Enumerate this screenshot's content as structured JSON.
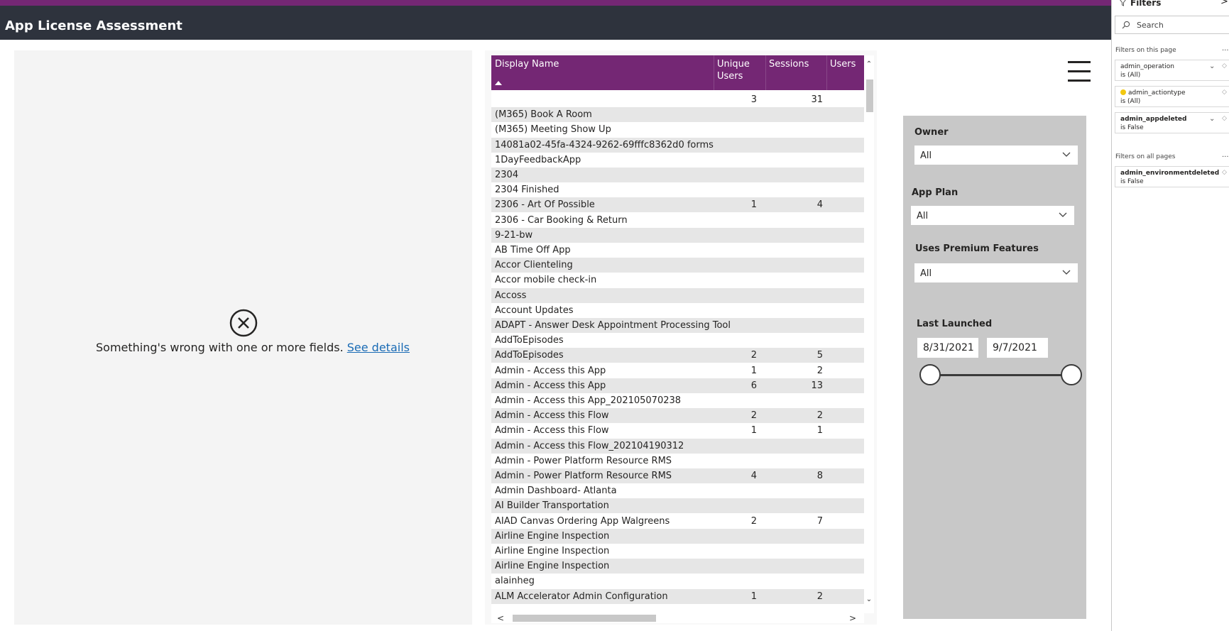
{
  "header": {
    "title": "App License Assessment"
  },
  "error": {
    "message": "Something's wrong with one or more fields.",
    "link": "See details"
  },
  "table": {
    "columns": [
      "Display Name",
      "Unique Users",
      "Sessions",
      "Users"
    ],
    "rows": [
      {
        "name": "",
        "unique_users": "3",
        "sessions": "31"
      },
      {
        "name": "(M365) Book A Room",
        "unique_users": "",
        "sessions": ""
      },
      {
        "name": "(M365) Meeting Show Up",
        "unique_users": "",
        "sessions": ""
      },
      {
        "name": "14081a02-45fa-4324-9262-69fffc8362d0 forms",
        "unique_users": "",
        "sessions": ""
      },
      {
        "name": "1DayFeedbackApp",
        "unique_users": "",
        "sessions": ""
      },
      {
        "name": "2304",
        "unique_users": "",
        "sessions": ""
      },
      {
        "name": "2304 Finished",
        "unique_users": "",
        "sessions": ""
      },
      {
        "name": "2306 - Art Of Possible",
        "unique_users": "1",
        "sessions": "4"
      },
      {
        "name": "2306 - Car Booking & Return",
        "unique_users": "",
        "sessions": ""
      },
      {
        "name": "9-21-bw",
        "unique_users": "",
        "sessions": ""
      },
      {
        "name": "AB Time Off App",
        "unique_users": "",
        "sessions": ""
      },
      {
        "name": "Accor Clienteling",
        "unique_users": "",
        "sessions": ""
      },
      {
        "name": "Accor mobile check-in",
        "unique_users": "",
        "sessions": ""
      },
      {
        "name": "Accoss",
        "unique_users": "",
        "sessions": ""
      },
      {
        "name": "Account Updates",
        "unique_users": "",
        "sessions": ""
      },
      {
        "name": "ADAPT - Answer Desk Appointment Processing Tool",
        "unique_users": "",
        "sessions": ""
      },
      {
        "name": "AddToEpisodes",
        "unique_users": "",
        "sessions": ""
      },
      {
        "name": "AddToEpisodes",
        "unique_users": "2",
        "sessions": "5"
      },
      {
        "name": "Admin - Access this App",
        "unique_users": "1",
        "sessions": "2"
      },
      {
        "name": "Admin - Access this App",
        "unique_users": "6",
        "sessions": "13"
      },
      {
        "name": "Admin - Access this App_202105070238",
        "unique_users": "",
        "sessions": ""
      },
      {
        "name": "Admin - Access this Flow",
        "unique_users": "2",
        "sessions": "2"
      },
      {
        "name": "Admin - Access this Flow",
        "unique_users": "1",
        "sessions": "1"
      },
      {
        "name": "Admin - Access this Flow_202104190312",
        "unique_users": "",
        "sessions": ""
      },
      {
        "name": "Admin - Power Platform Resource RMS",
        "unique_users": "",
        "sessions": ""
      },
      {
        "name": "Admin - Power Platform Resource RMS",
        "unique_users": "4",
        "sessions": "8"
      },
      {
        "name": "Admin Dashboard- Atlanta",
        "unique_users": "",
        "sessions": ""
      },
      {
        "name": "AI Builder Transportation",
        "unique_users": "",
        "sessions": ""
      },
      {
        "name": "AIAD Canvas Ordering App Walgreens",
        "unique_users": "2",
        "sessions": "7"
      },
      {
        "name": "Airline Engine Inspection",
        "unique_users": "",
        "sessions": ""
      },
      {
        "name": "Airline Engine Inspection",
        "unique_users": "",
        "sessions": ""
      },
      {
        "name": "Airline Engine Inspection",
        "unique_users": "",
        "sessions": ""
      },
      {
        "name": "alainheg",
        "unique_users": "",
        "sessions": ""
      },
      {
        "name": "ALM Accelerator Admin Configuration",
        "unique_users": "1",
        "sessions": "2"
      }
    ]
  },
  "slicers": {
    "owner": {
      "label": "Owner",
      "value": "All"
    },
    "app_plan": {
      "label": "App Plan",
      "value": "All"
    },
    "premium": {
      "label": "Uses Premium Features",
      "value": "All"
    },
    "last_launched": {
      "label": "Last Launched",
      "start": "8/31/2021",
      "end": "9/7/2021"
    }
  },
  "filters": {
    "title": "Filters",
    "search_placeholder": "Search",
    "on_this_page_label": "Filters on this page",
    "on_all_pages_label": "Filters on all pages",
    "page_filters": [
      {
        "name": "admin_operation",
        "value": "is (All)"
      },
      {
        "name": "admin_actiontype",
        "value": "is (All)"
      },
      {
        "name": "admin_appdeleted",
        "value": "is False"
      }
    ],
    "all_page_filters": [
      {
        "name": "admin_environmentdeleted",
        "value": "is False"
      }
    ]
  },
  "colors": {
    "accent": "#742774",
    "titlebar": "#2e333d",
    "slicer_bg": "#c8c8c8"
  }
}
